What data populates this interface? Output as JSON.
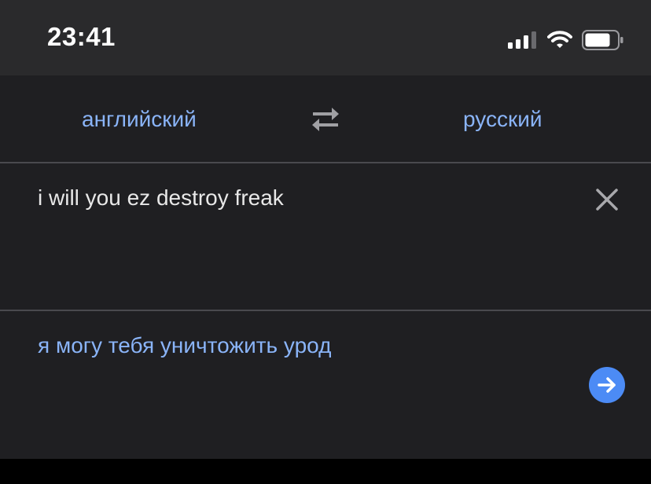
{
  "status_bar": {
    "time": "23:41",
    "icons": [
      "cellular-signal-icon",
      "wifi-icon",
      "battery-icon"
    ]
  },
  "languages": {
    "source": "английский",
    "target": "русский",
    "swap_icon": "swap-arrows-icon"
  },
  "input": {
    "text": "i will you ez destroy freak",
    "clear_icon": "close-icon"
  },
  "output": {
    "text": "я могу тебя уничтожить урод",
    "action_icon": "arrow-right-icon"
  },
  "colors": {
    "accent": "#8ab4f8",
    "button": "#4c8bf5",
    "panel": "#1f1f22",
    "status_bar": "#2a2a2c",
    "divider": "#4a4a4e"
  }
}
